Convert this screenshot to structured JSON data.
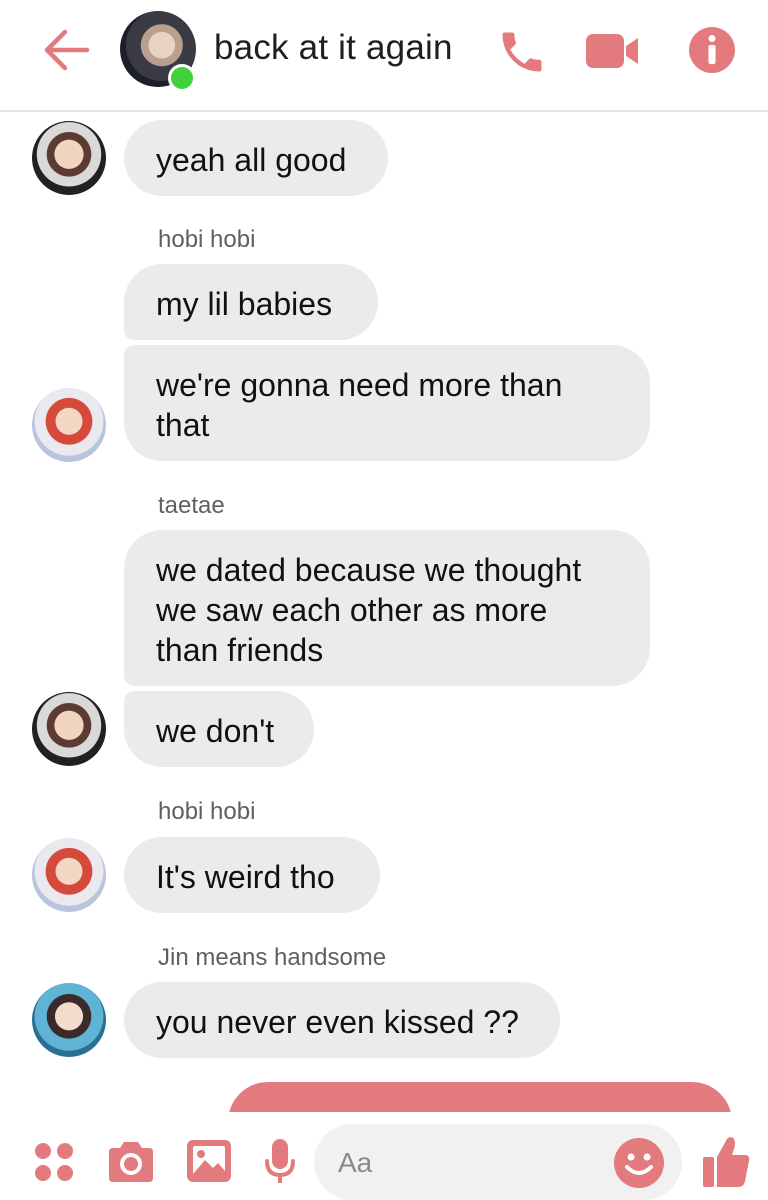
{
  "accent_color": "#e37b7e",
  "header": {
    "title": "back at it again",
    "icons": [
      "back-arrow-icon",
      "phone-icon",
      "video-camera-icon",
      "info-icon"
    ]
  },
  "messages": {
    "m1": {
      "text": "yeah all good"
    },
    "s1": {
      "name": "hobi hobi"
    },
    "m2": {
      "text": "my lil babies"
    },
    "m3": {
      "line1": "we're gonna need more than",
      "line2": "that"
    },
    "s2": {
      "name": "taetae"
    },
    "m4": {
      "line1": "we dated because we thought",
      "line2": "we saw each other as more",
      "line3": "than friends"
    },
    "m5": {
      "text": "we don't"
    },
    "s3": {
      "name": "hobi hobi"
    },
    "m6": {
      "text": "It's weird tho"
    },
    "s4": {
      "name": "Jin means handsome"
    },
    "m7": {
      "text": "you never even kissed ??"
    }
  },
  "composer": {
    "placeholder": "Aa",
    "icons": [
      "apps-icon",
      "camera-icon",
      "image-icon",
      "microphone-icon",
      "emoji-icon",
      "thumbs-up-icon"
    ]
  }
}
